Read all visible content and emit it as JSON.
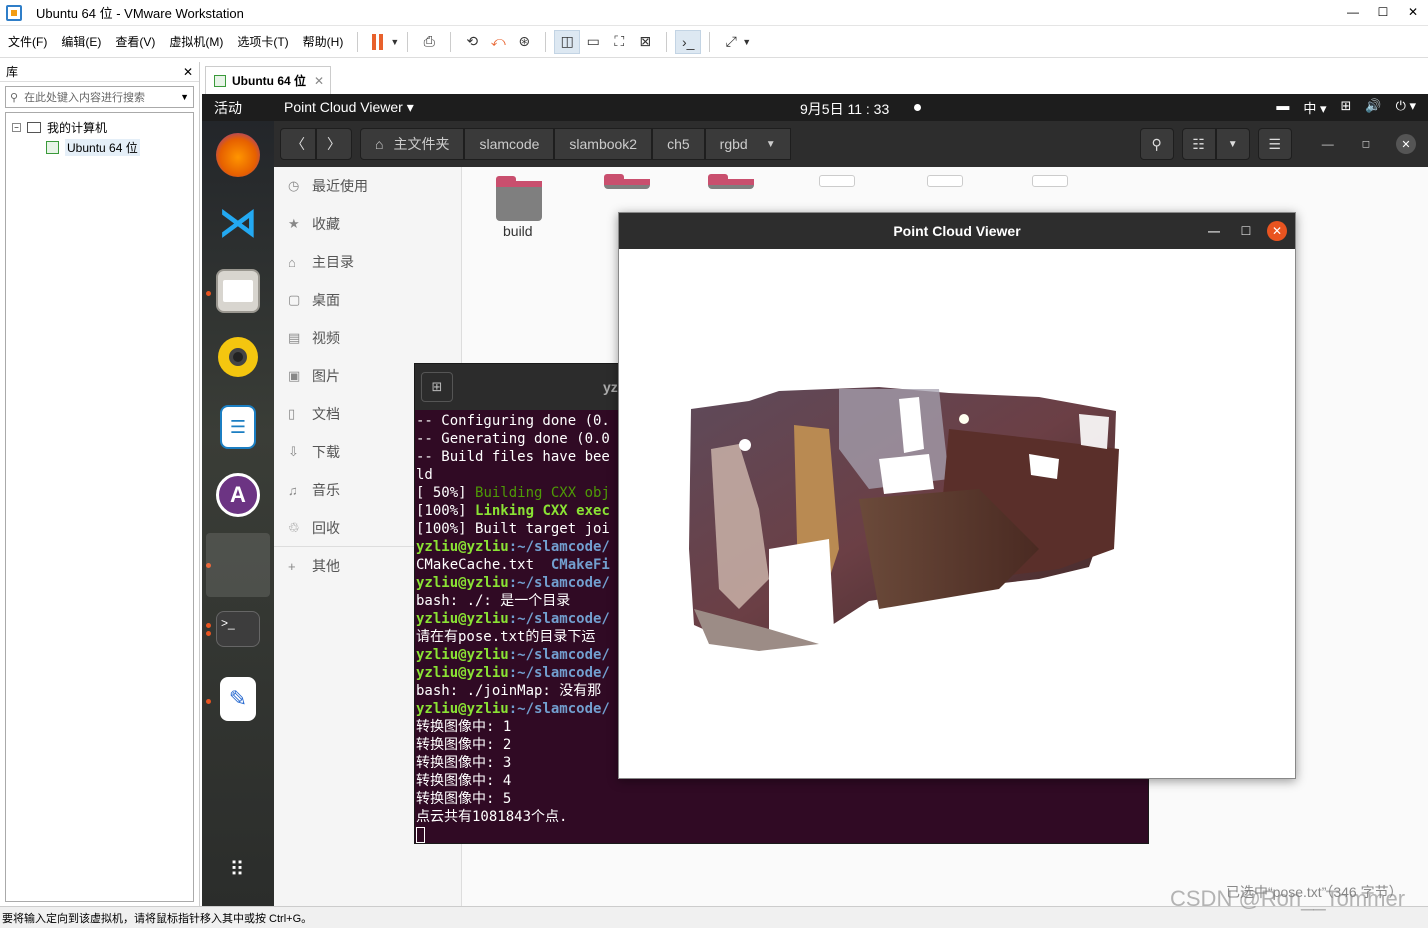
{
  "window": {
    "title": "Ubuntu 64 位 - VMware Workstation"
  },
  "menu": {
    "items": [
      "文件(F)",
      "编辑(E)",
      "查看(V)",
      "虚拟机(M)",
      "选项卡(T)",
      "帮助(H)"
    ]
  },
  "library": {
    "title": "库",
    "search_placeholder": "在此处键入内容进行搜索",
    "tree": {
      "root": "我的计算机",
      "child": "Ubuntu 64 位"
    }
  },
  "vm_tab": {
    "label": "Ubuntu 64 位"
  },
  "ubuntu_topbar": {
    "activities": "活动",
    "app_name": "Point Cloud Viewer",
    "clock": "9月5日  11 : 33",
    "input_method": "中"
  },
  "nautilus": {
    "home_label": "主文件夹",
    "breadcrumbs": [
      "slamcode",
      "slambook2",
      "ch5",
      "rgbd"
    ],
    "sidebar": [
      "最近使用",
      "收藏",
      "主目录",
      "桌面",
      "视频",
      "图片",
      "文档",
      "下载",
      "音乐",
      "回收",
      "其他"
    ],
    "folder_label": "build"
  },
  "terminal": {
    "title": "yzl",
    "lines": [
      {
        "t": "-- Configuring done (0.",
        "c": ""
      },
      {
        "t": "-- Generating done (0.0",
        "c": ""
      },
      {
        "t": "-- Build files have bee",
        "c": ""
      },
      {
        "t": "ld",
        "c": ""
      },
      {
        "t": "[ 50%] ",
        "c": "",
        "rest": "Building CXX obj",
        "rc": "gr"
      },
      {
        "t": "[100%] ",
        "c": "",
        "rest": "Linking CXX exec",
        "rc": "g"
      },
      {
        "t": "[100%] Built target joi",
        "c": ""
      },
      {
        "t": "yzliu@yzliu",
        "c": "g",
        "rest": ":~/slamcode/",
        "rc": "b"
      },
      {
        "t": "CMakeCache.txt  ",
        "c": "",
        "rest": "CMakeFi",
        "rc": "b"
      },
      {
        "t": "yzliu@yzliu",
        "c": "g",
        "rest": ":~/slamcode/",
        "rc": "b"
      },
      {
        "t": "bash: ./: 是一个目录",
        "c": ""
      },
      {
        "t": "yzliu@yzliu",
        "c": "g",
        "rest": ":~/slamcode/",
        "rc": "b"
      },
      {
        "t": "请在有pose.txt的目录下运",
        "c": ""
      },
      {
        "t": "yzliu@yzliu",
        "c": "g",
        "rest": ":~/slamcode/",
        "rc": "b"
      },
      {
        "t": "yzliu@yzliu",
        "c": "g",
        "rest": ":~/slamcode/",
        "rc": "b"
      },
      {
        "t": "bash: ./joinMap: 没有那",
        "c": ""
      },
      {
        "t": "yzliu@yzliu",
        "c": "g",
        "rest": ":~/slamcode/",
        "rc": "b"
      },
      {
        "t": "转换图像中: 1",
        "c": ""
      },
      {
        "t": "转换图像中: 2",
        "c": ""
      },
      {
        "t": "转换图像中: 3",
        "c": ""
      },
      {
        "t": "转换图像中: 4",
        "c": ""
      },
      {
        "t": "转换图像中: 5",
        "c": ""
      },
      {
        "t": "点云共有1081843个点.",
        "c": ""
      }
    ]
  },
  "viewer": {
    "title": "Point Cloud Viewer"
  },
  "status": {
    "left": "要将输入定向到该虚拟机，请将鼠标指针移入其中或按 Ctrl+G。",
    "selection": "已选中“pose.txt”（346 字节）",
    "watermark": "CSDN @Ron__Tommer"
  },
  "colors": {
    "ubuntu_orange": "#e95420",
    "terminal_bg": "#300a24",
    "prompt_green": "#8ae234",
    "path_blue": "#729fcf"
  }
}
